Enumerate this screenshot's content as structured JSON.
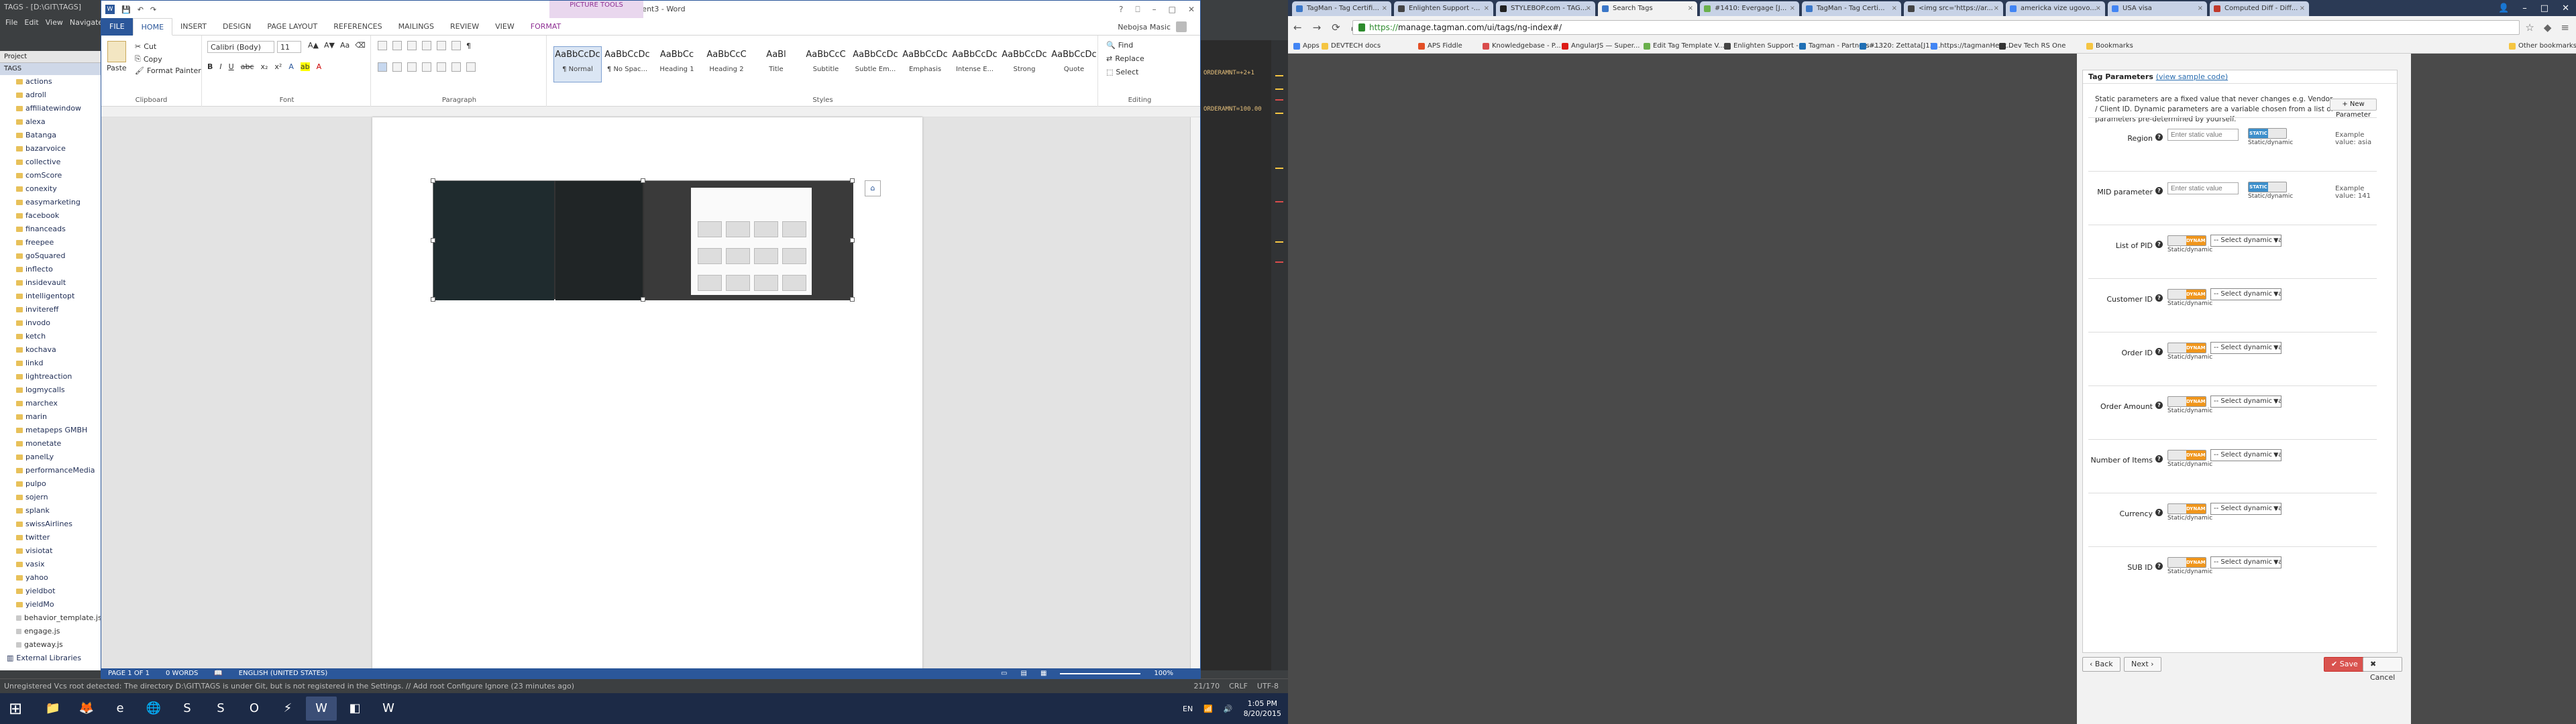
{
  "ide": {
    "title": "TAGS - [D:\\GIT\\TAGS]",
    "menu": [
      "File",
      "Edit",
      "View",
      "Navigate"
    ],
    "project_label": "Project",
    "root_label": "TAGS",
    "tree": [
      "actions",
      "adroll",
      "affiliatewindow",
      "alexa",
      "Batanga",
      "bazarvoice",
      "collective",
      "comScore",
      "conexity",
      "easymarketing",
      "facebook",
      "financeads",
      "freepee",
      "goSquared",
      "inflecto",
      "insidevault",
      "intelligentopt",
      "invitereff",
      "invodo",
      "ketch",
      "kochava",
      "linkd",
      "lightreaction",
      "logmycalls",
      "marchex",
      "marin",
      "metapeps GMBH",
      "monetate",
      "panelLy",
      "performanceMedia",
      "pulpo",
      "sojern",
      "splank",
      "swissAirlines",
      "twitter",
      "visiotat",
      "vasix",
      "yahoo",
      "yieldbot",
      "yieldMo"
    ],
    "files": [
      "behavior_template.js",
      "engage.js",
      "gateway.js"
    ],
    "external": "External Libraries",
    "code_lines": [
      "ORDERAMNT=+2+1",
      "ORDERAMNT=100.00"
    ],
    "status": "Unregistered Vcs root detected: The directory D:\\GIT\\TAGS is under Git, but is not registered in the Settings. // Add root  Configure  Ignore (23 minutes ago)",
    "status_right": [
      "21/170",
      "CRLF",
      "UTF-8"
    ]
  },
  "word": {
    "quick_access": [
      "💾",
      "↶",
      "↷"
    ],
    "doc_title": "Document3 - Word",
    "picture_tools": "PICTURE TOOLS",
    "window_buttons": [
      "?",
      "⎕",
      "–",
      "□",
      "✕"
    ],
    "tabs": [
      "FILE",
      "HOME",
      "INSERT",
      "DESIGN",
      "PAGE LAYOUT",
      "REFERENCES",
      "MAILINGS",
      "REVIEW",
      "VIEW",
      "FORMAT"
    ],
    "user": "Nebojsa Masic",
    "clipboard": {
      "paste": "Paste",
      "cut": "Cut",
      "copy": "Copy",
      "painter": "Format Painter",
      "label": "Clipboard"
    },
    "font": {
      "name": "Calibri (Body)",
      "size": "11",
      "label": "Font"
    },
    "paragraph_label": "Paragraph",
    "styles": [
      {
        "preview": "AaBbCcDc",
        "name": "¶ Normal"
      },
      {
        "preview": "AaBbCcDc",
        "name": "¶ No Spac..."
      },
      {
        "preview": "AaBbCc",
        "name": "Heading 1"
      },
      {
        "preview": "AaBbCcC",
        "name": "Heading 2"
      },
      {
        "preview": "AaBl",
        "name": "Title"
      },
      {
        "preview": "AaBbCcC",
        "name": "Subtitle"
      },
      {
        "preview": "AaBbCcDc",
        "name": "Subtle Em..."
      },
      {
        "preview": "AaBbCcDc",
        "name": "Emphasis"
      },
      {
        "preview": "AaBbCcDc",
        "name": "Intense E..."
      },
      {
        "preview": "AaBbCcDc",
        "name": "Strong"
      },
      {
        "preview": "AaBbCcDc",
        "name": "Quote"
      }
    ],
    "styles_label": "Styles",
    "editing": {
      "find": "Find",
      "replace": "Replace",
      "select": "Select",
      "label": "Editing"
    },
    "status": {
      "page": "PAGE 1 OF 1",
      "words": "0 WORDS",
      "lang": "ENGLISH (UNITED STATES)",
      "zoom": "100%"
    }
  },
  "taskbar": {
    "clock_time": "1:05 PM",
    "clock_date": "8/20/2015",
    "lang": "EN",
    "apps": [
      "📁",
      "🦊",
      "e",
      "🌐",
      "S",
      "S",
      "O",
      "⚡",
      "W",
      "◧",
      "W"
    ]
  },
  "browser": {
    "tabs": [
      {
        "title": "TagMan - Tag Certifi...",
        "color": "#3b77c8"
      },
      {
        "title": "Enlighten Support -...",
        "color": "#444"
      },
      {
        "title": "STYLEBOP.com - TAG...",
        "color": "#222"
      },
      {
        "title": "Search Tags",
        "color": "#3b77c8"
      },
      {
        "title": "#1410: Evergage [J...",
        "color": "#6ab04c"
      },
      {
        "title": "TagMan - Tag Certi...",
        "color": "#3b77c8"
      },
      {
        "title": "<img src='https://ar...",
        "color": "#444"
      },
      {
        "title": "americka vize ugovo...",
        "color": "#4285f4"
      },
      {
        "title": "USA visa",
        "color": "#4285f4"
      },
      {
        "title": "Computed Diff - Diff...",
        "color": "#c0392b"
      }
    ],
    "window_buttons": [
      "👤",
      "–",
      "□",
      "✕"
    ],
    "url_https": "https://",
    "url_rest": "manage.tagman.com/ui/tags/ng-index#/",
    "bookmarks": [
      "Apps",
      "DEVTECH docs",
      "APS Fiddle",
      "Knowledgebase - P...",
      "AngularJS — Super...",
      "Edit Tag Template V...",
      "Enlighten Support -...",
      "Tagman - Partners -...",
      "#1320: Zettata[J13...",
      "https://tagmanHet.t...",
      "Dev Tech RS One",
      "Bookmarks",
      "Other bookmarks"
    ],
    "panel": {
      "heading": "Tag Parameters",
      "sample_link": "(view sample code)",
      "description": "Static parameters are a fixed value that never changes e.g. Vendor / Client ID. Dynamic parameters are a variable chosen from a list of parameters pre-determined by yourself.",
      "new_param": "+ New Parameter",
      "static_placeholder": "Enter static value",
      "dynamic_placeholder": "-- Select dynamic value --",
      "static_label": "STATIC",
      "dynamic_label": "DYNAMIC",
      "sd_text": "Static/dynamic",
      "params": [
        {
          "label": "Region",
          "mode": "static",
          "example": "Example value: asia"
        },
        {
          "label": "MID parameter",
          "mode": "static",
          "example": "Example value: 141"
        },
        {
          "label": "List of PID",
          "mode": "dynamic",
          "example": ""
        },
        {
          "label": "Customer ID",
          "mode": "dynamic",
          "example": ""
        },
        {
          "label": "Order ID",
          "mode": "dynamic",
          "example": ""
        },
        {
          "label": "Order Amount",
          "mode": "dynamic",
          "example": ""
        },
        {
          "label": "Number of Items",
          "mode": "dynamic",
          "example": ""
        },
        {
          "label": "Currency",
          "mode": "dynamic",
          "example": ""
        },
        {
          "label": "SUB ID",
          "mode": "dynamic",
          "example": ""
        }
      ],
      "back": "Back",
      "next": "Next",
      "save": "Save",
      "cancel": "Cancel"
    }
  }
}
